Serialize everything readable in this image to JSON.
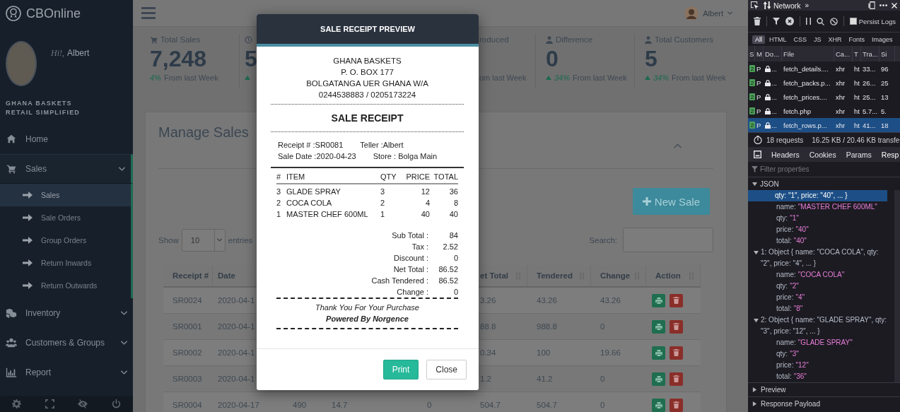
{
  "sidebar": {
    "brand": "CBOnline",
    "greeting": "Hi!,",
    "user": "Albert",
    "company_lines": [
      "GHANA BASKETS",
      "RETAIL SIMPLIFIED"
    ],
    "menu": [
      {
        "label": "Home",
        "kind": "link",
        "selected": false
      },
      {
        "label": "Sales",
        "kind": "group",
        "selected": true,
        "expanded": true,
        "children": [
          {
            "label": "Sales",
            "selected": true
          },
          {
            "label": "Sale Orders",
            "selected": false
          },
          {
            "label": "Group Orders",
            "selected": false
          },
          {
            "label": "Return Inwards",
            "selected": false
          },
          {
            "label": "Return Outwards",
            "selected": false
          }
        ]
      },
      {
        "label": "Inventory",
        "kind": "group",
        "selected": false,
        "expanded": false
      },
      {
        "label": "Customers & Groups",
        "kind": "group",
        "selected": false,
        "expanded": false
      },
      {
        "label": "Report",
        "kind": "group",
        "selected": false,
        "expanded": false
      }
    ]
  },
  "topbar": {
    "user": "Albert"
  },
  "stats": [
    {
      "label": "Total Sales",
      "value": "7,248",
      "change_pct": "4%",
      "change_text": "From last Week",
      "trend_up": false
    },
    {
      "value": "5",
      "trend_up": true
    },
    {
      "label": "roduced",
      "change_text": "om last Week",
      "trend_up": false
    },
    {
      "label": "Difference",
      "value": "0",
      "change_pct": "34%",
      "change_text": "From last Week",
      "trend_up": true
    },
    {
      "label": "Total Customers",
      "value": "5",
      "change_pct": "34%",
      "change_text": "From last Week",
      "trend_up": true
    }
  ],
  "panel": {
    "title": "Manage Sales",
    "new_button": "New Sale",
    "show_label": "Show",
    "page_size": "10",
    "entries_label": "entries",
    "search_label": "Search:"
  },
  "table": {
    "columns": [
      {
        "label": "Receipt #",
        "sortable": false
      },
      {
        "label": "Date"
      },
      {},
      {},
      {},
      {
        "label": "et Total",
        "sortable": true
      },
      {
        "label": "Tendered",
        "sortable": true
      },
      {
        "label": "Change",
        "sortable": true
      },
      {
        "label": "Action",
        "sortable": true
      }
    ],
    "rows": [
      {
        "receipt": "SR0024",
        "date": "2020-04-1",
        "net_total": "3.26",
        "tendered": "43.26",
        "change": "43.26"
      },
      {
        "receipt": "SR0001",
        "date": "2020-04-1",
        "net_total": "88.8",
        "tendered": "988.8",
        "change": "0"
      },
      {
        "receipt": "SR0002",
        "date": "2020-04-1",
        "net_total": "0.34",
        "tendered": "100",
        "change": "19.66"
      },
      {
        "receipt": "SR0003",
        "date": "2020-04-1",
        "net_total": "1.2",
        "tendered": "41.2",
        "change": "0"
      },
      {
        "receipt": "SR0004",
        "date": "2020-04-17",
        "column_3": "490",
        "column_4": "14.7",
        "column_5": "0",
        "net_total": "504.7",
        "tendered": "504.7",
        "change": "0"
      }
    ]
  },
  "modal": {
    "title": "SALE RECEIPT PREVIEW",
    "receipt": {
      "header_lines": [
        "GHANA BASKETS",
        "P. O. BOX 177",
        "BOLGATANGA UER GHANA W/A",
        "0244538883 / 0205173224"
      ],
      "title": "SALE RECEIPT",
      "info": [
        [
          "Receipt # :SR0081",
          "Teller :Albert"
        ],
        [
          "Sale Date :2020-04-23",
          "Store : Bolga Main"
        ]
      ],
      "columns": [
        "#",
        "ITEM",
        "QTY",
        "PRICE",
        "TOTAL"
      ],
      "items": [
        {
          "no": "3",
          "item": "GLADE SPRAY",
          "qty": "3",
          "price": "12",
          "total": "36"
        },
        {
          "no": "2",
          "item": "COCA COLA",
          "qty": "2",
          "price": "4",
          "total": "8"
        },
        {
          "no": "1",
          "item": "MASTER CHEF 600ML",
          "qty": "1",
          "price": "40",
          "total": "40"
        }
      ],
      "totals": [
        {
          "label": "Sub Total :",
          "value": "84"
        },
        {
          "label": "Tax :",
          "value": "2.52"
        },
        {
          "label": "Discount :",
          "value": "0"
        },
        {
          "label": "Net Total :",
          "value": "86.52"
        },
        {
          "label": "Cash Tendered :",
          "value": "86.52"
        },
        {
          "label": "Change :",
          "value": "0"
        }
      ],
      "footer_lines": [
        "Thank You For Your Purchase",
        "Powered By Norgence"
      ]
    },
    "buttons": [
      {
        "label": "Print",
        "kind": "primary"
      },
      {
        "label": "Close",
        "kind": "default"
      }
    ]
  },
  "devtools": {
    "panel_title": "Network",
    "more": "»",
    "persist_logs": {
      "label": "Persist Logs",
      "checked": false
    },
    "filters": [
      {
        "label": "All",
        "selected": true
      },
      {
        "label": "HTML",
        "selected": false
      },
      {
        "label": "CSS",
        "selected": false
      },
      {
        "label": "JS",
        "selected": false
      },
      {
        "label": "XHR",
        "selected": false
      },
      {
        "label": "Fonts",
        "selected": false
      },
      {
        "label": "Images",
        "selected": false
      }
    ],
    "columns": [
      "S",
      "M",
      "Do...",
      "File",
      "Ca...",
      "T",
      "Tra...",
      "Si"
    ],
    "requests": [
      {
        "status": "2",
        "method": "P",
        "domain": "...",
        "file": "fetch_details....",
        "cause": "xhr",
        "type": "ht",
        "transferred": "33...",
        "size": "96",
        "selected": false
      },
      {
        "status": "2",
        "method": "P",
        "domain": "...",
        "file": "fetch_packs.p...",
        "cause": "xhr",
        "type": "ht",
        "transferred": "26...",
        "size": "25",
        "selected": false
      },
      {
        "status": "2",
        "method": "P",
        "domain": "...",
        "file": "fetch_prices....",
        "cause": "xhr",
        "type": "ht",
        "transferred": "25...",
        "size": "13",
        "selected": false
      },
      {
        "status": "2",
        "method": "P",
        "domain": "...",
        "file": "fetch.php",
        "cause": "xhr",
        "type": "ht",
        "transferred": "5.7...",
        "size": "5.",
        "selected": false
      },
      {
        "status": "2",
        "method": "P",
        "domain": "...",
        "file": "fetch_rows.p...",
        "cause": "xhr",
        "type": "ht",
        "transferred": "41...",
        "size": "18",
        "selected": true
      }
    ],
    "summary": {
      "requests": "18 requests",
      "transfer": "16.25 KB / 20.46 KB transfe"
    },
    "detail_tabs": [
      {
        "label": "Headers",
        "selected": false
      },
      {
        "label": "Cookies",
        "selected": false
      },
      {
        "label": "Params",
        "selected": false
      },
      {
        "label": "Resp",
        "selected": true
      }
    ],
    "filter_placeholder": "Filter properties",
    "tree": {
      "label": "JSON",
      "expanded": true,
      "children": [
        {
          "text": "qty: \"1\", price: \"40\", ... }",
          "selected": true,
          "children": [
            {
              "key": "name:",
              "value": "\"MASTER CHEF 600ML\""
            },
            {
              "key": "qty:",
              "value": "\"1\""
            },
            {
              "key": "price:",
              "value": "\"40\""
            },
            {
              "key": "total:",
              "value": "\"40\""
            }
          ]
        },
        {
          "text": "1: Object { name: \"COCA COLA\", qty: \"2\", price: \"4\", ... }",
          "selected": false,
          "expanded": true,
          "children": [
            {
              "key": "name:",
              "value": "\"COCA COLA\""
            },
            {
              "key": "qty:",
              "value": "\"2\""
            },
            {
              "key": "price:",
              "value": "\"4\""
            },
            {
              "key": "total:",
              "value": "\"8\""
            }
          ]
        },
        {
          "text": "2: Object { name: \"GLADE SPRAY\", qty: \"3\", price: \"12\", ... }",
          "selected": false,
          "expanded": true,
          "children": [
            {
              "key": "name:",
              "value": "\"GLADE SPRAY\""
            },
            {
              "key": "qty:",
              "value": "\"3\""
            },
            {
              "key": "price:",
              "value": "\"12\""
            },
            {
              "key": "total:",
              "value": "\"36\""
            }
          ]
        }
      ]
    },
    "sections": [
      {
        "label": "Preview",
        "expanded": false
      },
      {
        "label": "Response Payload",
        "expanded": false
      }
    ]
  }
}
